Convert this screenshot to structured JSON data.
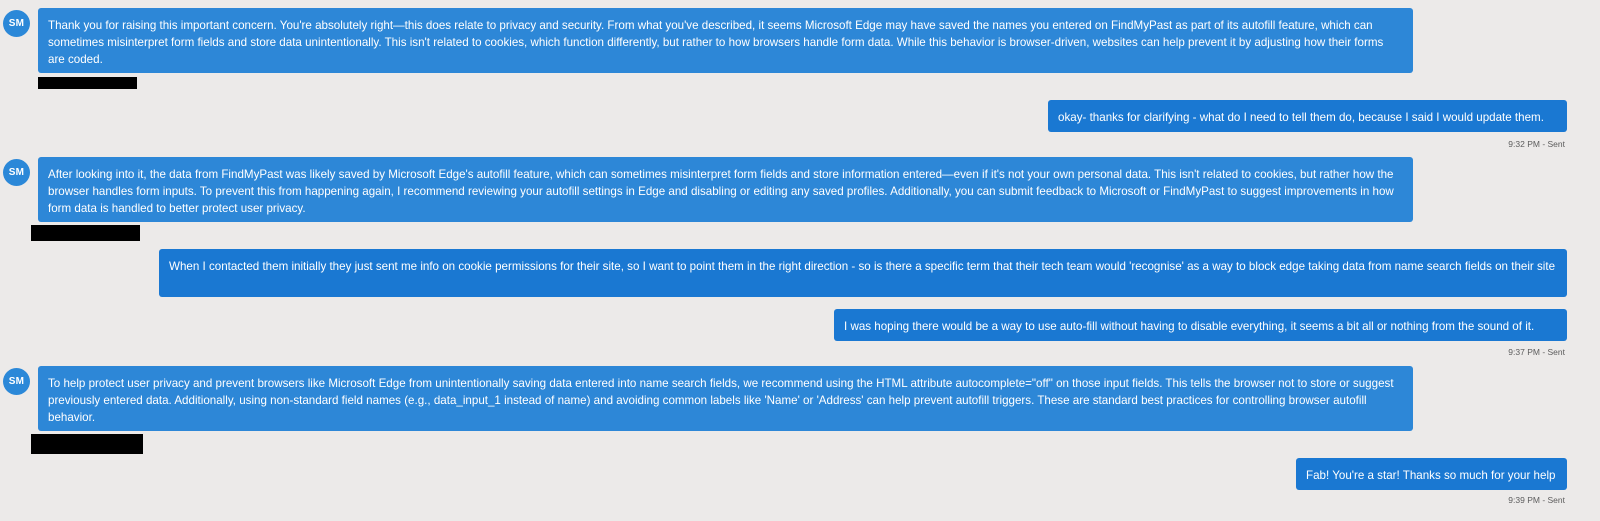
{
  "messages": [
    {
      "sender": "agent",
      "avatar_initials": "SM",
      "text": "Thank you for raising this important concern. You're absolutely right—this does relate to privacy and security. From what you've described, it seems Microsoft Edge may have saved the names you entered on FindMyPast as part of its autofill feature, which can sometimes misinterpret form fields and store data unintentionally. This isn't related to cookies, which function differently, but rather to how browsers handle form data. While this behavior is browser-driven, websites can help prevent it by adjusting how their forms are coded."
    },
    {
      "sender": "user",
      "text": "okay- thanks for clarifying - what do I need to tell them do, because I said I would update them.",
      "timestamp": "9:32 PM - Sent"
    },
    {
      "sender": "agent",
      "avatar_initials": "SM",
      "text": "After looking into it, the data from FindMyPast was likely saved by Microsoft Edge's autofill feature, which can sometimes misinterpret form fields and store information entered—even if it's not your own personal data. This isn't related to cookies, but rather how the browser handles form inputs. To prevent this from happening again, I recommend reviewing your autofill settings in Edge and disabling or editing any saved profiles. Additionally, you can submit feedback to Microsoft or FindMyPast to suggest improvements in how form data is handled to better protect user privacy."
    },
    {
      "sender": "user",
      "text": "When I contacted them initially they just sent me info on cookie permissions for their site, so I want to point them in the right direction - so is there a specific term that their tech team would 'recognise' as a way to block edge taking data from name search fields on their site"
    },
    {
      "sender": "user",
      "text": "I was hoping there would be a way to use auto-fill without having to disable everything, it seems a bit all or nothing from the sound of it.",
      "timestamp": "9:37 PM - Sent"
    },
    {
      "sender": "agent",
      "avatar_initials": "SM",
      "text": "To help protect user privacy and prevent browsers like Microsoft Edge from unintentionally saving data entered into name search fields, we recommend using the HTML attribute autocomplete=\"off\" on those input fields. This tells the browser not to store or suggest previously entered data. Additionally, using non-standard field names (e.g., data_input_1 instead of name) and avoiding common labels like 'Name' or 'Address' can help prevent autofill triggers. These are standard best practices for controlling browser autofill behavior."
    },
    {
      "sender": "user",
      "text": "Fab! You're a star! Thanks so much for your help",
      "timestamp": "9:39 PM - Sent"
    }
  ],
  "colors": {
    "background": "#eceae9",
    "agent_bubble": "#2d87d7",
    "user_bubble": "#1a78d2",
    "avatar": "#2b88d8",
    "redaction": "#000000"
  }
}
